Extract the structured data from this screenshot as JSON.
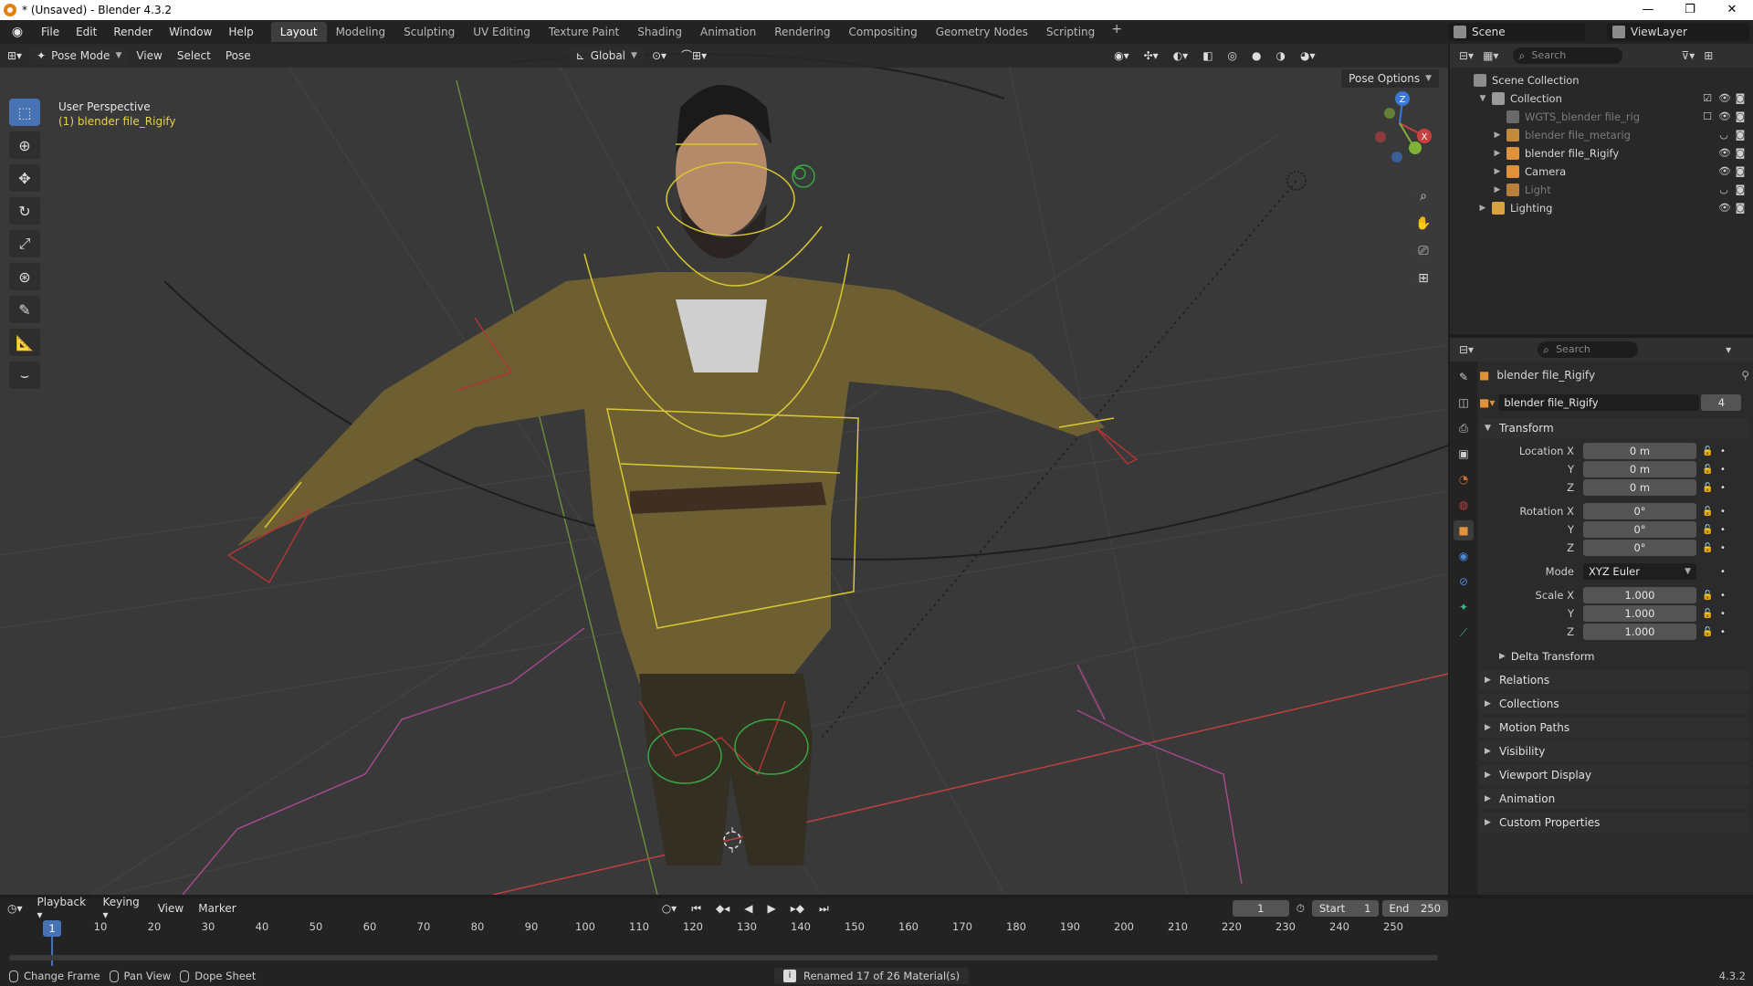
{
  "window": {
    "title": "* (Unsaved) - Blender 4.3.2",
    "controls": [
      "—",
      "❐",
      "✕"
    ]
  },
  "menu": [
    "File",
    "Edit",
    "Render",
    "Window",
    "Help"
  ],
  "workspaces": [
    "Layout",
    "Modeling",
    "Sculpting",
    "UV Editing",
    "Texture Paint",
    "Shading",
    "Animation",
    "Rendering",
    "Compositing",
    "Geometry Nodes",
    "Scripting"
  ],
  "workspace_add": "+",
  "scene": {
    "name": "Scene",
    "view_layer": "ViewLayer"
  },
  "viewport": {
    "mode": "Pose Mode",
    "menus": [
      "View",
      "Select",
      "Pose"
    ],
    "orientation": "Global",
    "perspective_label": "User Perspective",
    "object_label": "(1) blender file_Rigify",
    "pose_options": "Pose Options",
    "gizmo_axes": {
      "x": "X",
      "y": "Y",
      "z": "Z"
    },
    "colors": {
      "background": "#393939",
      "x_axis": "#c8403f",
      "y_axis": "#7fb336",
      "z_axis": "#3c78d8",
      "rig_yellow": "#d9c832",
      "rig_green": "#39a845"
    }
  },
  "tools": [
    "select-box-icon",
    "cursor-icon",
    "move-icon",
    "rotate-icon",
    "scale-icon",
    "transform-icon",
    "annotate-icon",
    "measure-icon",
    "bone-curve-icon"
  ],
  "outliner": {
    "search_placeholder": "Search",
    "rows": [
      {
        "label": "Scene Collection",
        "level": 0,
        "icon": "#8c8c8c",
        "dim": false
      },
      {
        "label": "Collection",
        "level": 1,
        "icon": "#9a9a9a",
        "dim": false
      },
      {
        "label": "WGTS_blender file_rig",
        "level": 2,
        "icon": "#6a6a6a",
        "dim": true
      },
      {
        "label": "blender file_metarig",
        "level": 2,
        "icon": "#c28a3b",
        "dim": true
      },
      {
        "label": "blender file_Rigify",
        "level": 2,
        "icon": "#e0913a",
        "dim": false
      },
      {
        "label": "Camera",
        "level": 2,
        "icon": "#e0913a",
        "dim": false
      },
      {
        "label": "Light",
        "level": 2,
        "icon": "#b8803a",
        "dim": true
      },
      {
        "label": "Lighting",
        "level": 1,
        "icon": "#d6a340",
        "dim": false
      }
    ]
  },
  "properties": {
    "search_placeholder": "Search",
    "object_name": "blender file_Rigify",
    "datablock_name": "blender file_Rigify",
    "user_count": "4",
    "transform_label": "Transform",
    "location": {
      "label": "Location X",
      "x": "0 m",
      "y": "0 m",
      "z": "0 m"
    },
    "rotation": {
      "label": "Rotation X",
      "x": "0°",
      "y": "0°",
      "z": "0°"
    },
    "mode": {
      "label": "Mode",
      "value": "XYZ Euler"
    },
    "scale": {
      "label": "Scale X",
      "x": "1.000",
      "y": "1.000",
      "z": "1.000"
    },
    "axis_labels": {
      "y": "Y",
      "z": "Z"
    },
    "delta_transform": "Delta Transform",
    "sections": [
      "Relations",
      "Collections",
      "Motion Paths",
      "Visibility",
      "Viewport Display",
      "Animation",
      "Custom Properties"
    ]
  },
  "timeline": {
    "menus": [
      "Playback",
      "Keying",
      "View",
      "Marker"
    ],
    "current_frame": "1",
    "start_label": "Start",
    "start": "1",
    "end_label": "End",
    "end": "250",
    "ticks": [
      "10",
      "20",
      "30",
      "40",
      "50",
      "60",
      "70",
      "80",
      "90",
      "100",
      "110",
      "120",
      "130",
      "140",
      "150",
      "160",
      "170",
      "180",
      "190",
      "200",
      "210",
      "220",
      "230",
      "240",
      "250"
    ]
  },
  "statusbar": {
    "items": [
      "Change Frame",
      "Pan View",
      "Dope Sheet"
    ],
    "message": "Renamed 17 of 26 Material(s)",
    "version": "4.3.2"
  }
}
